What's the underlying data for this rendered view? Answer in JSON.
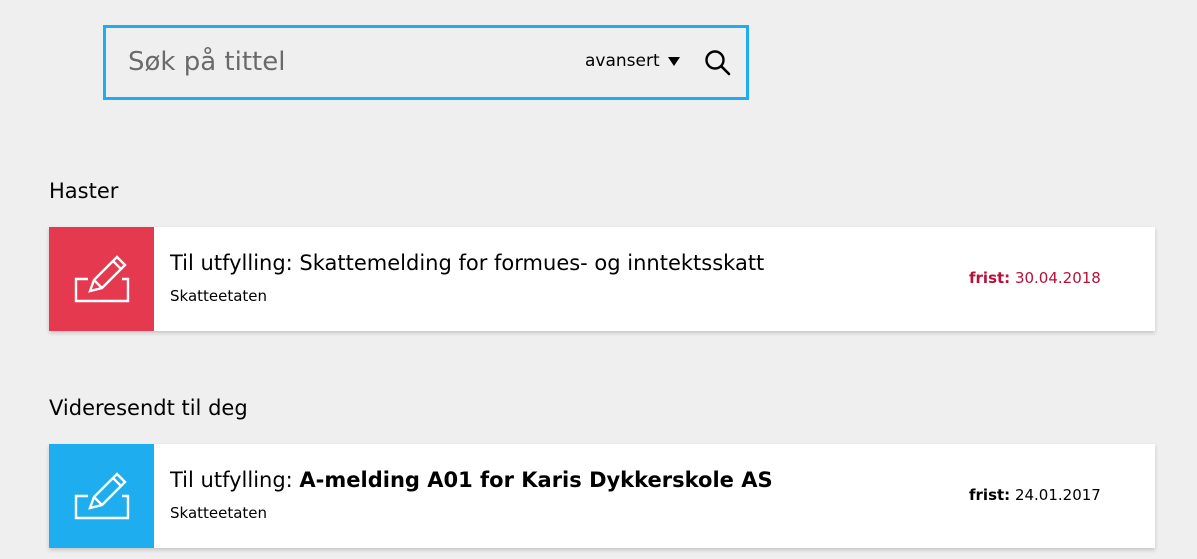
{
  "search": {
    "placeholder": "Søk på tittel",
    "advanced_label": "avansert"
  },
  "sections": [
    {
      "heading": "Haster",
      "item": {
        "prefix": "Til utfylling: ",
        "title": "Skattemelding for formues- og inntektsskatt",
        "sender": "Skatteetaten",
        "deadline_label": "frist:",
        "deadline_value": "30.04.2018",
        "icon": "edit-form-icon"
      }
    },
    {
      "heading": "Videresendt til deg",
      "item": {
        "prefix": "Til utfylling: ",
        "title": "A-melding A01 for Karis Dykkerskole AS",
        "sender": "Skatteetaten",
        "deadline_label": "frist:",
        "deadline_value": "24.01.2017",
        "icon": "edit-form-icon"
      }
    }
  ],
  "colors": {
    "search_border": "#1eaef0",
    "urgent_tile": "#e53950",
    "urgent_deadline": "#b8103a",
    "forwarded_tile": "#1eaef0",
    "background": "#efefef"
  }
}
